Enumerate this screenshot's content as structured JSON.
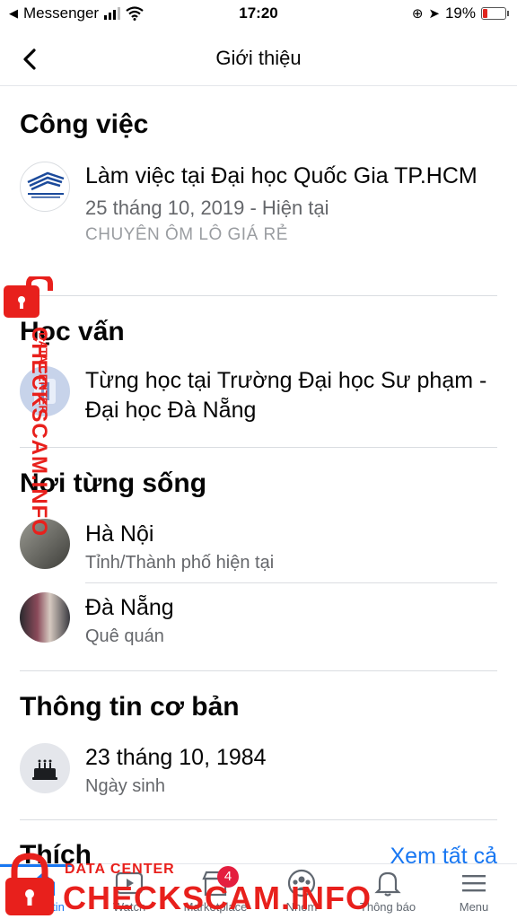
{
  "status_bar": {
    "back_app": "Messenger",
    "time": "17:20",
    "battery": "19%"
  },
  "header": {
    "title": "Giới thiệu"
  },
  "work": {
    "title": "Công việc",
    "line1": "Làm việc tại Đại học Quốc Gia TP.HCM",
    "dates": "25 tháng 10, 2019 - Hiện tại",
    "position": "CHUYÊN ÔM LÔ GIÁ RẺ"
  },
  "education": {
    "title": "Học vấn",
    "line1": "Từng học tại Trường Đại học Sư phạm - Đại học Đà Nẵng"
  },
  "places": {
    "title": "Nơi từng sống",
    "items": [
      {
        "name": "Hà Nội",
        "type": "Tỉnh/Thành phố hiện tại"
      },
      {
        "name": "Đà Nẵng",
        "type": "Quê quán"
      }
    ]
  },
  "basic_info": {
    "title": "Thông tin cơ bản",
    "birthday": "23 tháng 10, 1984",
    "birthday_label": "Ngày sinh"
  },
  "likes": {
    "title": "Thích",
    "see_all": "Xem tất cả"
  },
  "tabbar": {
    "tabs": [
      {
        "label": "Bảng tin"
      },
      {
        "label": "Watch"
      },
      {
        "label": "Marketplace",
        "badge": "4"
      },
      {
        "label": "Nhóm"
      },
      {
        "label": "Thông báo"
      },
      {
        "label": "Menu"
      }
    ]
  },
  "watermark": {
    "side_small": "DATA CENTER",
    "side_large": "CHECKSCAM.INFO",
    "bottom_title": "DATA CENTER",
    "bottom_brand": "CHECKSCAM.INFO"
  },
  "colors": {
    "accent": "#1877f2",
    "watermark": "#e8201c",
    "badge": "#e41e3f"
  }
}
